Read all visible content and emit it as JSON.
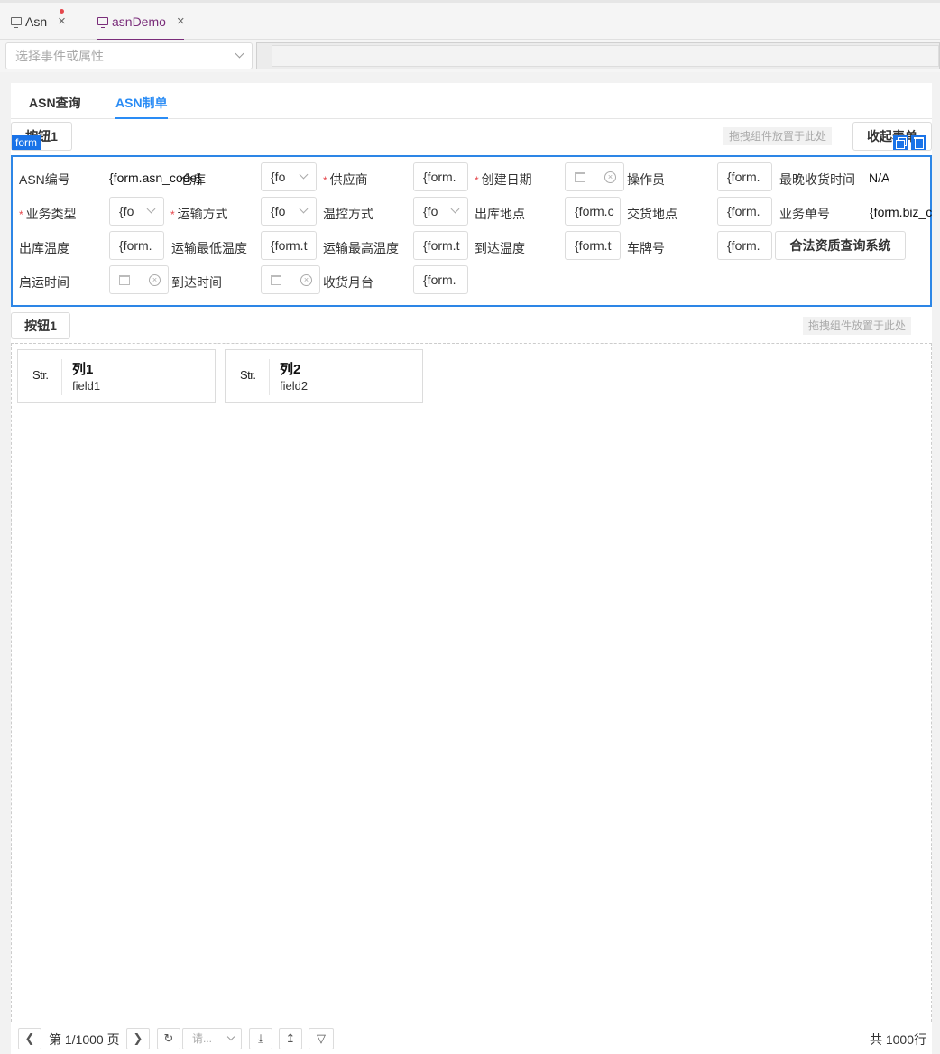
{
  "tabs": [
    {
      "label": "Asn",
      "close": "×"
    },
    {
      "label": "asnDemo",
      "close": "×"
    }
  ],
  "event_select": {
    "placeholder": "选择事件或属性"
  },
  "inner_tabs": [
    "ASN查询",
    "ASN制单"
  ],
  "toolbar1": {
    "button": "按钮1",
    "drop_hint": "拖拽组件放置于此处",
    "collapse": "收起表单"
  },
  "form_tag": "form",
  "form": {
    "asn_code_label": "ASN编号",
    "asn_code_value": "{form.asn_code}",
    "overlap_label": "仓库",
    "supplier_label": "供应商",
    "supplier_value": "{form.",
    "create_date_label": "创建日期",
    "operator_label": "操作员",
    "operator_value": "{form.",
    "latest_receive_label": "最晚收货时间",
    "latest_receive_value": "N/A",
    "biz_type_label": "业务类型",
    "biz_type_value": "{fo",
    "transport_label": "运输方式",
    "transport_value": "{fo",
    "temp_ctrl_label": "温控方式",
    "temp_ctrl_value": "{fo",
    "out_place_label": "出库地点",
    "out_place_value": "{form.c",
    "delivery_place_label": "交货地点",
    "delivery_place_value": "{form.",
    "biz_no_label": "业务单号",
    "biz_no_value": "{form.biz_c",
    "out_temp_label": "出库温度",
    "out_temp_value": "{form.",
    "min_temp_label": "运输最低温度",
    "min_temp_value": "{form.t",
    "max_temp_label": "运输最高温度",
    "max_temp_value": "{form.t",
    "arrive_temp_label": "到达温度",
    "arrive_temp_value": "{form.t",
    "plate_label": "车牌号",
    "plate_value": "{form.",
    "qualify_button": "合法资质查询系统",
    "depart_time_label": "启运时间",
    "arrive_time_label": "到达时间",
    "dock_label": "收货月台",
    "dock_value": "{form."
  },
  "toolbar2": {
    "button": "按钮1",
    "drop_hint": "拖拽组件放置于此处"
  },
  "columns": [
    {
      "type": "Str.",
      "title": "列1",
      "field": "field1"
    },
    {
      "type": "Str.",
      "title": "列2",
      "field": "field2"
    }
  ],
  "pagination": {
    "page_text": "第 1/1000 页",
    "page_size_placeholder": "请...",
    "total": "共 1000行"
  }
}
